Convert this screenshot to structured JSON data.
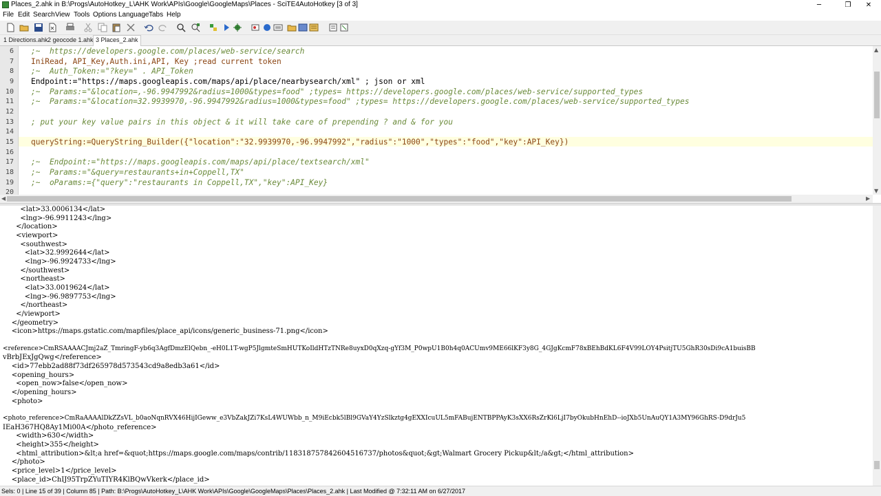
{
  "window": {
    "title": "Places_2.ahk in B:\\Progs\\AutoHotkey_L\\AHK Work\\APIs\\Google\\GoogleMaps\\Places - SciTE4AutoHotkey [3 of 3]",
    "minimize": "─",
    "restore": "❐",
    "close": "✕"
  },
  "menu": [
    "File",
    "Edit",
    "Search",
    "View",
    "Tools",
    "Options",
    "Language",
    "Tabs",
    "Help"
  ],
  "toolbar_icons": [
    "new-file-icon",
    "open-folder-icon",
    "save-icon",
    "close-file-icon",
    "print-icon",
    "cut-icon",
    "copy-icon",
    "paste-icon",
    "delete-icon",
    "undo-icon",
    "redo-icon",
    "find-icon",
    "replace-icon",
    "compile-icon",
    "run-icon",
    "debug-icon",
    "tool-icon-1",
    "tool-icon-2",
    "tool-icon-3",
    "tool-icon-4",
    "tool-icon-5",
    "tool-icon-6",
    "tool-icon-7",
    "tool-icon-8"
  ],
  "tabs": [
    {
      "label": "1 Directions.ahk",
      "active": false
    },
    {
      "label": "2 geocode 1.ahk",
      "active": false
    },
    {
      "label": "3 Places_2.ahk",
      "active": true
    }
  ],
  "editor": {
    "line_numbers": [
      "6",
      "7",
      "8",
      "9",
      "10",
      "11",
      "12",
      "13",
      "14",
      "15",
      "16",
      "17",
      "18",
      "19",
      "20"
    ],
    "lines": [
      ";~  https://developers.google.com/places/web-service/search",
      "IniRead, API_Key,Auth.ini,API, Key ;read current token",
      ";~  Auth_Token:=\"?key=\" . API_Token",
      "Endpoint:=\"https://maps.googleapis.com/maps/api/place/nearbysearch/xml\" ; json or xml",
      ";~  Params:=\"&location=,-96.9947992&radius=1000&types=food\" ;types= https://developers.google.com/places/web-service/supported_types",
      ";~  Params:=\"&location=32.9939970,-96.9947992&radius=1000&types=food\" ;types= https://developers.google.com/places/web-service/supported_types",
      "",
      "; put your key value pairs in this object & it will take care of prepending ? and & for you",
      "",
      "queryString:=QueryString_Builder({\"location\":\"32.9939970,-96.9947992\",\"radius\":\"1000\",\"types\":\"food\",\"key\":API_Key})",
      "",
      ";~  Endpoint:=\"https://maps.googleapis.com/maps/api/place/textsearch/xml\"",
      ";~  Params:=\"&query=restaurants+in+Coppell,TX\"",
      ";~  oParams:={\"query\":\"restaurants in Coppell,TX\",\"key\":API_Key}",
      ""
    ]
  },
  "output": [
    "        <lat>33.0006134</lat>",
    "        <lng>-96.9911243</lng>",
    "      </location>",
    "      <viewport>",
    "        <southwest>",
    "          <lat>32.9992644</lat>",
    "          <lng>-96.9924733</lng>",
    "        </southwest>",
    "        <northeast>",
    "          <lat>33.0019624</lat>",
    "          <lng>-96.9897753</lng>",
    "        </northeast>",
    "      </viewport>",
    "    </geometry>",
    "    <icon>https://maps.gstatic.com/mapfiles/place_api/icons/generic_business-71.png</icon>",
    "",
    "<reference>CmRSAAAACJmj2aZ_TmringF-yb6q3AgfDmzElQebn_-eH0L1T-wgP5JlgmteSmHUTKoIldHTzTNRe8uyxD0qXzq-gYf3M_P0wpU1B0h4q0ACUmv9ME66lKF3y8G_4GJgKcmF78xBEhBdKL6F4V99LOY4PsitjTU5GhR30sDi9cA1buisBB",
    "vBrbJExJgQwg</reference>",
    "    <id>77ebb2ad88f73df265978d573543cd9a8edb3a61</id>",
    "    <opening_hours>",
    "      <open_now>false</open_now>",
    "    </opening_hours>",
    "    <photo>",
    "",
    "<photo_reference>CmRaAAAAlDkZZsVL_b0aoNqnRVX46HijIGeww_e3VbZakJZi7KsL4WUWbb_n_M9iEcbk5lBl9GVaY4YzSlkztg4gEXXIcuUL5mFABujENTBPPAyK3sXX6RsZrKl6LjI7byOkubHnEhD--ioJXb5UnAuQY1A3MY96GhRS-D9drJu5",
    "IEaH367HQ8Ay1Mi00A</photo_reference>",
    "      <width>630</width>",
    "      <height>355</height>",
    "      <html_attribution>&lt;a href=&quot;https://maps.google.com/maps/contrib/118318757842604516737/photos&quot;&gt;Walmart Grocery Pickup&lt;/a&gt;</html_attribution>",
    "    </photo>",
    "    <price_level>1</price_level>",
    "    <place_id>ChIJ95TrpZYuTIYR4KlBQwVkerk</place_id>"
  ],
  "status": "Sels: 0  |  Line 15 of 39  |  Column 85  |  Path: B:\\Progs\\AutoHotkey_L\\AHK Work\\APIs\\Google\\GoogleMaps\\Places\\Places_2.ahk  |  Last Modified @ 7:32:11 AM on 6/27/2017"
}
